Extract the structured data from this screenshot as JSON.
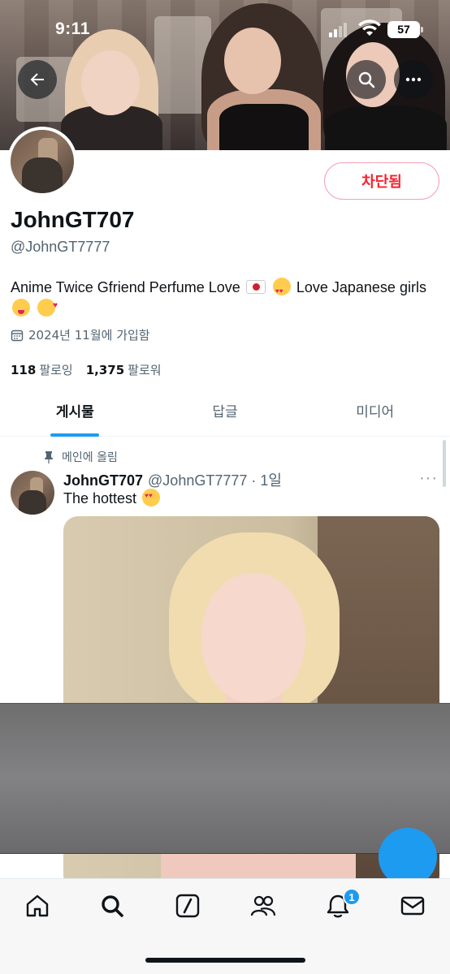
{
  "status_bar": {
    "time": "9:11",
    "battery": "57"
  },
  "header": {
    "icons": [
      "back-arrow-icon",
      "search-icon",
      "more-icon"
    ]
  },
  "profile": {
    "display_name": "JohnGT707",
    "handle": "@JohnGT7777",
    "bio_parts": {
      "p1": "Anime Twice Gfriend Perfume Love",
      "p2": "Love Japanese girls"
    },
    "bio_emojis": [
      "japan-flag",
      "heart-eyes",
      "hungry-face",
      "smiling-hearts"
    ],
    "joined": "2024년 11월에 가입함",
    "following_count": "118",
    "following_label": "팔로잉",
    "followers_count": "1,375",
    "followers_label": "팔로워",
    "blocked_label": "차단됨"
  },
  "tabs": [
    {
      "label": "게시물",
      "active": true
    },
    {
      "label": "답글",
      "active": false
    },
    {
      "label": "미디어",
      "active": false
    }
  ],
  "tweet": {
    "pinned_label": "메인에 올림",
    "name": "JohnGT707",
    "meta": "@JohnGT7777 · 1일",
    "text": "The hottest",
    "more": "···"
  },
  "bottom_nav": {
    "items": [
      "home-icon",
      "search-icon",
      "grok-icon",
      "communities-icon",
      "notifications-icon",
      "messages-icon"
    ],
    "notification_badge": "1"
  },
  "colors": {
    "accent": "#1d9bf0",
    "blocked_red": "#f4212e",
    "text": "#0f1419",
    "muted": "#536471"
  }
}
